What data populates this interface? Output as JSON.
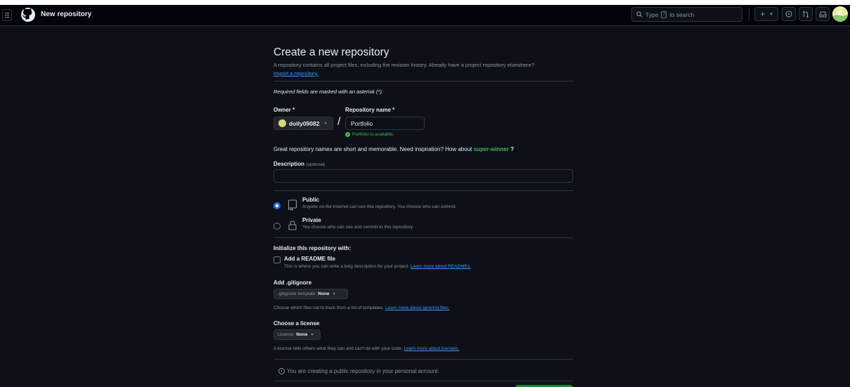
{
  "header": {
    "title": "New repository",
    "search_prefix": "Type",
    "search_key": "/",
    "search_suffix": "to search",
    "plus": "+",
    "caret": "▾"
  },
  "form": {
    "title": "Create a new repository",
    "subtitle": "A repository contains all project files, including the revision history. Already have a project repository elsewhere?",
    "import_link": "Import a repository.",
    "required_note": "Required fields are marked with an asterisk (*).",
    "owner_label": "Owner *",
    "owner_value": "dolly09082",
    "slash": "/",
    "repo_label": "Repository name *",
    "repo_value": "Portfolio",
    "available": "Portfolio is available.",
    "inspiration_prefix": "Great repository names are short and memorable. Need inspiration? How about",
    "inspiration_suggestion": "super-winner",
    "inspiration_suffix": "?",
    "description_label": "Description",
    "description_optional": "(optional)",
    "description_value": ""
  },
  "visibility": {
    "public_title": "Public",
    "public_desc": "Anyone on the internet can see this repository. You choose who can commit.",
    "private_title": "Private",
    "private_desc": "You choose who can see and commit to this repository.",
    "selected": "public"
  },
  "initialize": {
    "title": "Initialize this repository with:",
    "readme_title": "Add a README file",
    "readme_desc": "This is where you can write a long description for your project.",
    "readme_link": "Learn more about READMEs.",
    "readme_checked": false
  },
  "gitignore": {
    "title": "Add .gitignore",
    "select_prefix": ".gitignore template:",
    "select_value": "None",
    "help": "Choose which files not to track from a list of templates.",
    "help_link": "Learn more about ignoring files."
  },
  "license": {
    "title": "Choose a license",
    "select_prefix": "License:",
    "select_value": "None",
    "help": "A license tells others what they can and can't do with your code.",
    "help_link": "Learn more about licenses."
  },
  "footer": {
    "info": "You are creating a public repository in your personal account.",
    "info_icon": "i"
  },
  "colors": {
    "background": "#0d1117",
    "header": "#010409",
    "accent_link": "#4493f8",
    "success": "#3fb950",
    "primary_button": "#238636"
  }
}
